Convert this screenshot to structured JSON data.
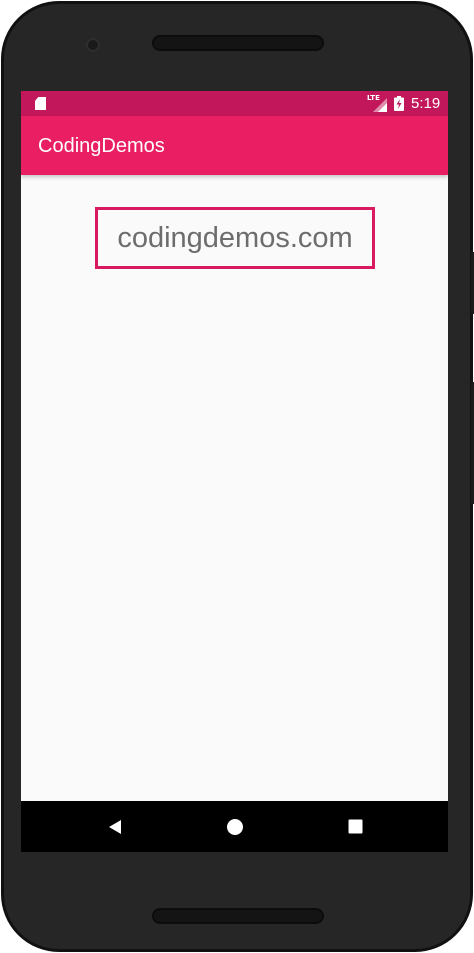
{
  "status_bar": {
    "network_label": "LTE",
    "time": "5:19",
    "icons": [
      "sd-card-icon",
      "lte-signal-icon",
      "battery-charging-icon"
    ]
  },
  "app_bar": {
    "title": "CodingDemos"
  },
  "content": {
    "text_view": "codingdemos.com"
  },
  "nav_bar": {
    "icons": [
      "back-icon",
      "home-icon",
      "recents-icon"
    ]
  },
  "colors": {
    "status_bar": "#c2185b",
    "app_bar": "#e91e63",
    "accent_border": "#d81b60",
    "text": "#6d6d6d",
    "background": "#fafafa",
    "nav_bar": "#000000"
  }
}
